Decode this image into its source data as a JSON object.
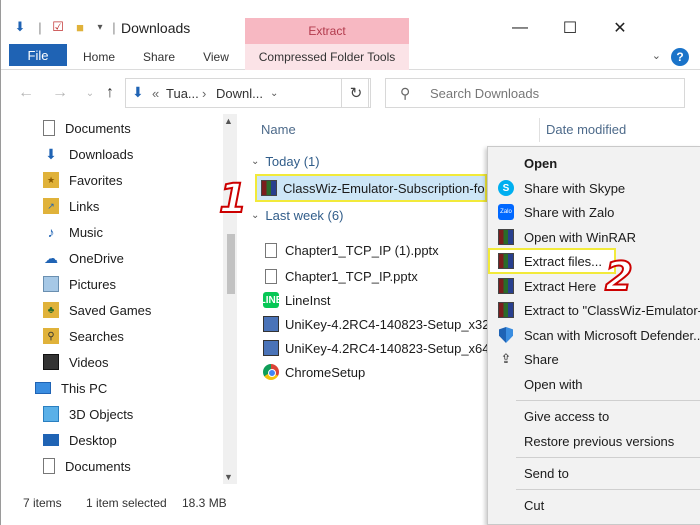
{
  "window": {
    "title": "Downloads",
    "controls": {
      "minimize": "—",
      "maximize": "☐",
      "close": "✕"
    }
  },
  "ribbon": {
    "contextual_label": "Extract",
    "tabs": [
      "File",
      "Home",
      "Share",
      "View",
      "Compressed Folder Tools"
    ]
  },
  "address": {
    "path_prefix": "«",
    "path": [
      "Tua...",
      "Downl..."
    ],
    "search_placeholder": "Search Downloads"
  },
  "nav_pane": {
    "items": [
      {
        "label": "Documents",
        "icon": "documents-icon"
      },
      {
        "label": "Downloads",
        "icon": "download-arrow-icon"
      },
      {
        "label": "Favorites",
        "icon": "favorites-folder-icon"
      },
      {
        "label": "Links",
        "icon": "links-folder-icon"
      },
      {
        "label": "Music",
        "icon": "music-note-icon"
      },
      {
        "label": "OneDrive",
        "icon": "onedrive-cloud-icon"
      },
      {
        "label": "Pictures",
        "icon": "pictures-icon"
      },
      {
        "label": "Saved Games",
        "icon": "saved-games-icon"
      },
      {
        "label": "Searches",
        "icon": "searches-icon"
      },
      {
        "label": "Videos",
        "icon": "videos-icon"
      },
      {
        "label": "This PC",
        "icon": "this-pc-icon"
      },
      {
        "label": "3D Objects",
        "icon": "3d-objects-icon"
      },
      {
        "label": "Desktop",
        "icon": "desktop-icon"
      },
      {
        "label": "Documents",
        "icon": "documents-icon"
      }
    ]
  },
  "file_list": {
    "columns": {
      "name": "Name",
      "date_modified": "Date modified"
    },
    "groups": [
      {
        "label": "Today (1)"
      },
      {
        "label": "Last week (6)"
      }
    ],
    "files": [
      {
        "name": "ClassWiz-Emulator-Subscription-fo",
        "icon": "winrar-archive-icon",
        "selected": true
      },
      {
        "name": "Chapter1_TCP_IP (1).pptx",
        "icon": "document-icon"
      },
      {
        "name": "Chapter1_TCP_IP.pptx",
        "icon": "document-icon"
      },
      {
        "name": "LineInst",
        "icon": "line-app-icon"
      },
      {
        "name": "UniKey-4.2RC4-140823-Setup_x32",
        "icon": "setup-icon"
      },
      {
        "name": "UniKey-4.2RC4-140823-Setup_x64",
        "icon": "setup-icon"
      },
      {
        "name": "ChromeSetup",
        "icon": "chrome-icon"
      }
    ]
  },
  "status": {
    "items_count": "7 items",
    "selection": "1 item selected",
    "size": "18.3 MB"
  },
  "context_menu": {
    "items": [
      {
        "label": "Open",
        "bold": true
      },
      {
        "label": "Share with Skype",
        "icon": "skype-icon"
      },
      {
        "label": "Share with Zalo",
        "icon": "zalo-icon"
      },
      {
        "label": "Open with WinRAR",
        "icon": "winrar-icon"
      },
      {
        "label": "Extract files...",
        "icon": "winrar-icon",
        "highlighted": true
      },
      {
        "label": "Extract Here",
        "icon": "winrar-icon"
      },
      {
        "label": "Extract to \"ClassWiz-Emulator-",
        "icon": "winrar-icon"
      },
      {
        "label": "Scan with Microsoft Defender...",
        "icon": "defender-icon"
      },
      {
        "label": "Share",
        "icon": "share-icon"
      },
      {
        "label": "Open with"
      },
      {
        "label": "Give access to"
      },
      {
        "label": "Restore previous versions"
      },
      {
        "label": "Send to"
      },
      {
        "label": "Cut"
      }
    ]
  },
  "annotations": {
    "step1": "1",
    "step2": "2"
  },
  "colors": {
    "accent": "#1f63b4",
    "highlight": "#f2ea3a",
    "selection": "#cde6f7",
    "contextual_tab": "#f7b8c2",
    "annotation": "#c00000"
  }
}
